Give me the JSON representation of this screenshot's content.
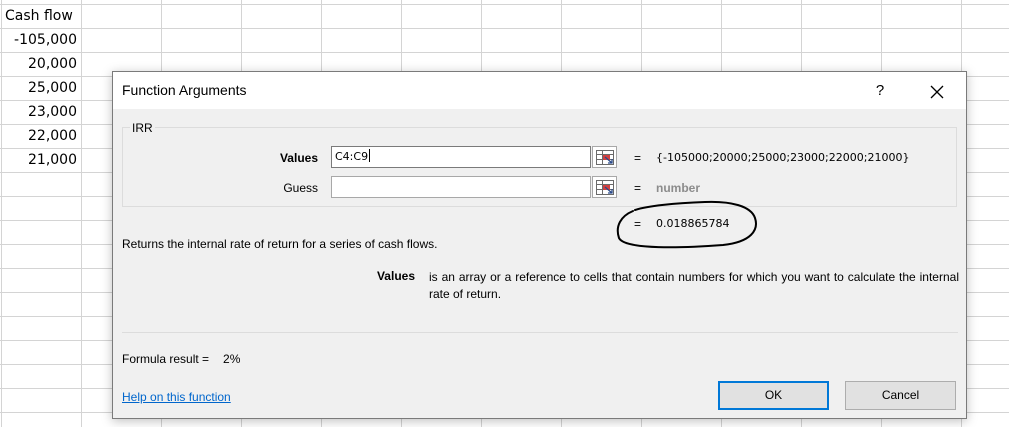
{
  "sheet": {
    "header": "Cash flow",
    "values": [
      "-105,000",
      "20,000",
      "25,000",
      "23,000",
      "22,000",
      "21,000"
    ]
  },
  "dialog": {
    "title": "Function Arguments",
    "help_glyph": "?",
    "close_glyph": "✕",
    "function_name": "IRR",
    "args": [
      {
        "label": "Values",
        "value": "C4:C9",
        "equals": "=",
        "evaluated": "{-105000;20000;25000;23000;22000;21000}"
      },
      {
        "label": "Guess",
        "value": "",
        "equals": "=",
        "evaluated": "number"
      }
    ],
    "result_equals": "=",
    "result": "0.018865784",
    "description": "Returns the internal rate of return for a series of cash flows.",
    "param_name": "Values",
    "param_description": "is an array or a reference to cells that contain numbers for which you want to calculate the internal rate of return.",
    "formula_result_label": "Formula result =",
    "formula_result_value": "2%",
    "help_link": "Help on this function",
    "ok_label": "OK",
    "cancel_label": "Cancel"
  }
}
